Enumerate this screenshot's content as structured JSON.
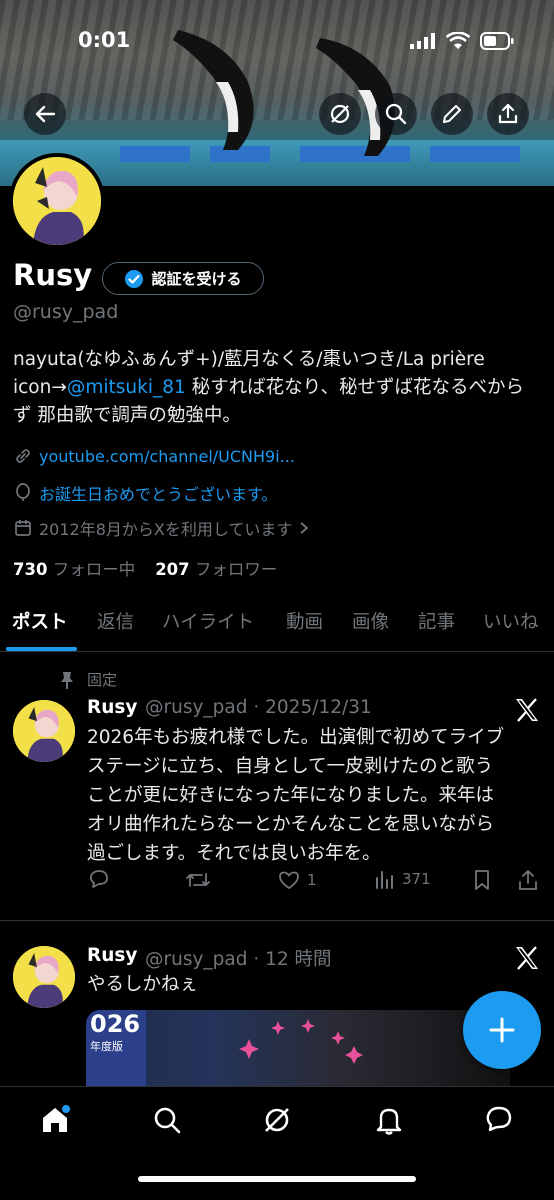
{
  "status_bar": {
    "time": "0:01"
  },
  "profile": {
    "name": "Rusy",
    "verify_label": "認証を受ける",
    "handle": "@rusy_pad",
    "bio_line1": "nayuta(なゆふぁんず+)/藍月なくる/棗いつき/La prière",
    "bio_prefix": "icon→",
    "bio_mention": "@mitsuki_81",
    "bio_rest": " 秘すれば花なり、秘せずば花なるべから",
    "bio_line3": "ず 那由歌で調声の勉強中。",
    "link": "youtube.com/channel/UCNH9i...",
    "birthday": "お誕生日おめでとうございます。",
    "joined": "2012年8月からXを利用しています",
    "following_count": "730",
    "following_label": "フォロー中",
    "followers_count": "207",
    "followers_label": "フォロワー"
  },
  "tabs": [
    "ポスト",
    "返信",
    "ハイライト",
    "動画",
    "画像",
    "記事",
    "いいね"
  ],
  "posts": [
    {
      "pinned_label": "固定",
      "name": "Rusy",
      "handle_date": "@rusy_pad · 2025/12/31",
      "lines": [
        "2026年もお疲れ様でした。出演側で初めてライブ",
        "ステージに立ち、自身として一皮剥けたのと歌う",
        "ことが更に好きになった年になりました。来年は",
        "オリ曲作れたらなーとかそんなことを思いながら",
        "過ごします。それでは良いお年を。"
      ],
      "likes": "1",
      "views": "371"
    },
    {
      "name": "Rusy",
      "handle_date": "@rusy_pad · 12 時間",
      "text": "やるしかねぇ",
      "image_text_1": "026",
      "image_text_2": "年度版"
    }
  ]
}
